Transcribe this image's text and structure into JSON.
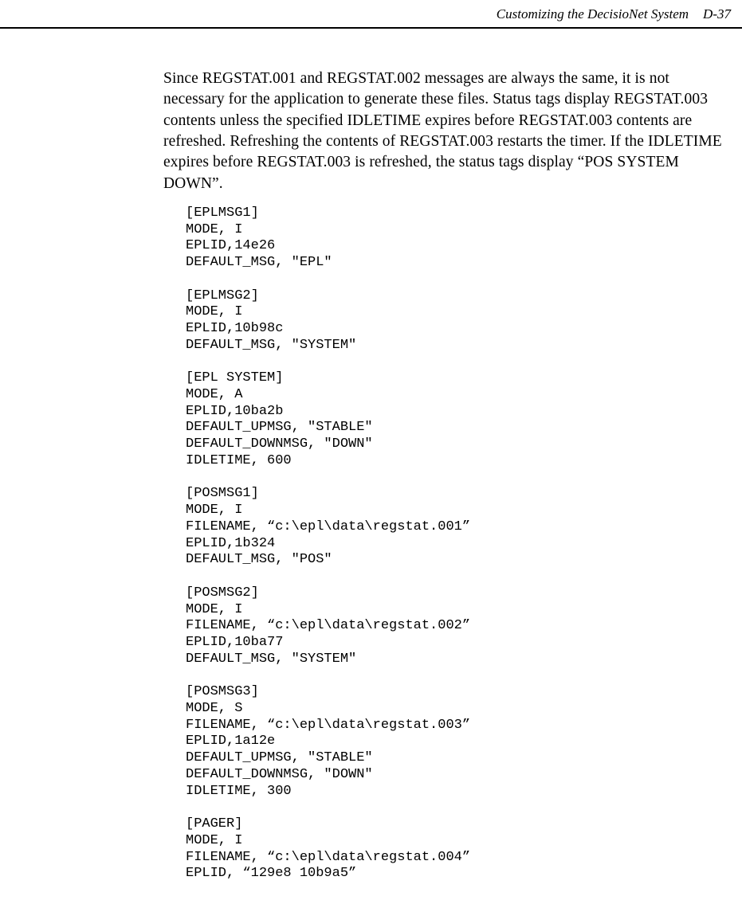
{
  "header": {
    "title": "Customizing the DecisioNet System",
    "page": "D-37"
  },
  "paragraph": "Since REGSTAT.001 and REGSTAT.002 messages are always the same, it is not necessary for the application to generate these files. Status tags display REGSTAT.003 contents unless the specified IDLETIME expires before REGSTAT.003 contents are refreshed. Refreshing the contents of REGSTAT.003 restarts the timer. If the IDLETIME expires before REGSTAT.003 is refreshed, the status tags display “POS SYSTEM DOWN”.",
  "code": "[EPLMSG1]\nMODE, I\nEPLID,14e26\nDEFAULT_MSG, \"EPL\"\n\n[EPLMSG2]\nMODE, I\nEPLID,10b98c\nDEFAULT_MSG, \"SYSTEM\"\n\n[EPL SYSTEM]\nMODE, A\nEPLID,10ba2b\nDEFAULT_UPMSG, \"STABLE\"\nDEFAULT_DOWNMSG, \"DOWN\"\nIDLETIME, 600\n\n[POSMSG1]\nMODE, I\nFILENAME, “c:\\epl\\data\\regstat.001”\nEPLID,1b324\nDEFAULT_MSG, \"POS\"\n\n[POSMSG2]\nMODE, I\nFILENAME, “c:\\epl\\data\\regstat.002”\nEPLID,10ba77\nDEFAULT_MSG, \"SYSTEM\"\n\n[POSMSG3]\nMODE, S\nFILENAME, “c:\\epl\\data\\regstat.003”\nEPLID,1a12e\nDEFAULT_UPMSG, \"STABLE\"\nDEFAULT_DOWNMSG, \"DOWN\"\nIDLETIME, 300\n\n[PAGER]\nMODE, I\nFILENAME, “c:\\epl\\data\\regstat.004”\nEPLID, “129e8 10b9a5”"
}
